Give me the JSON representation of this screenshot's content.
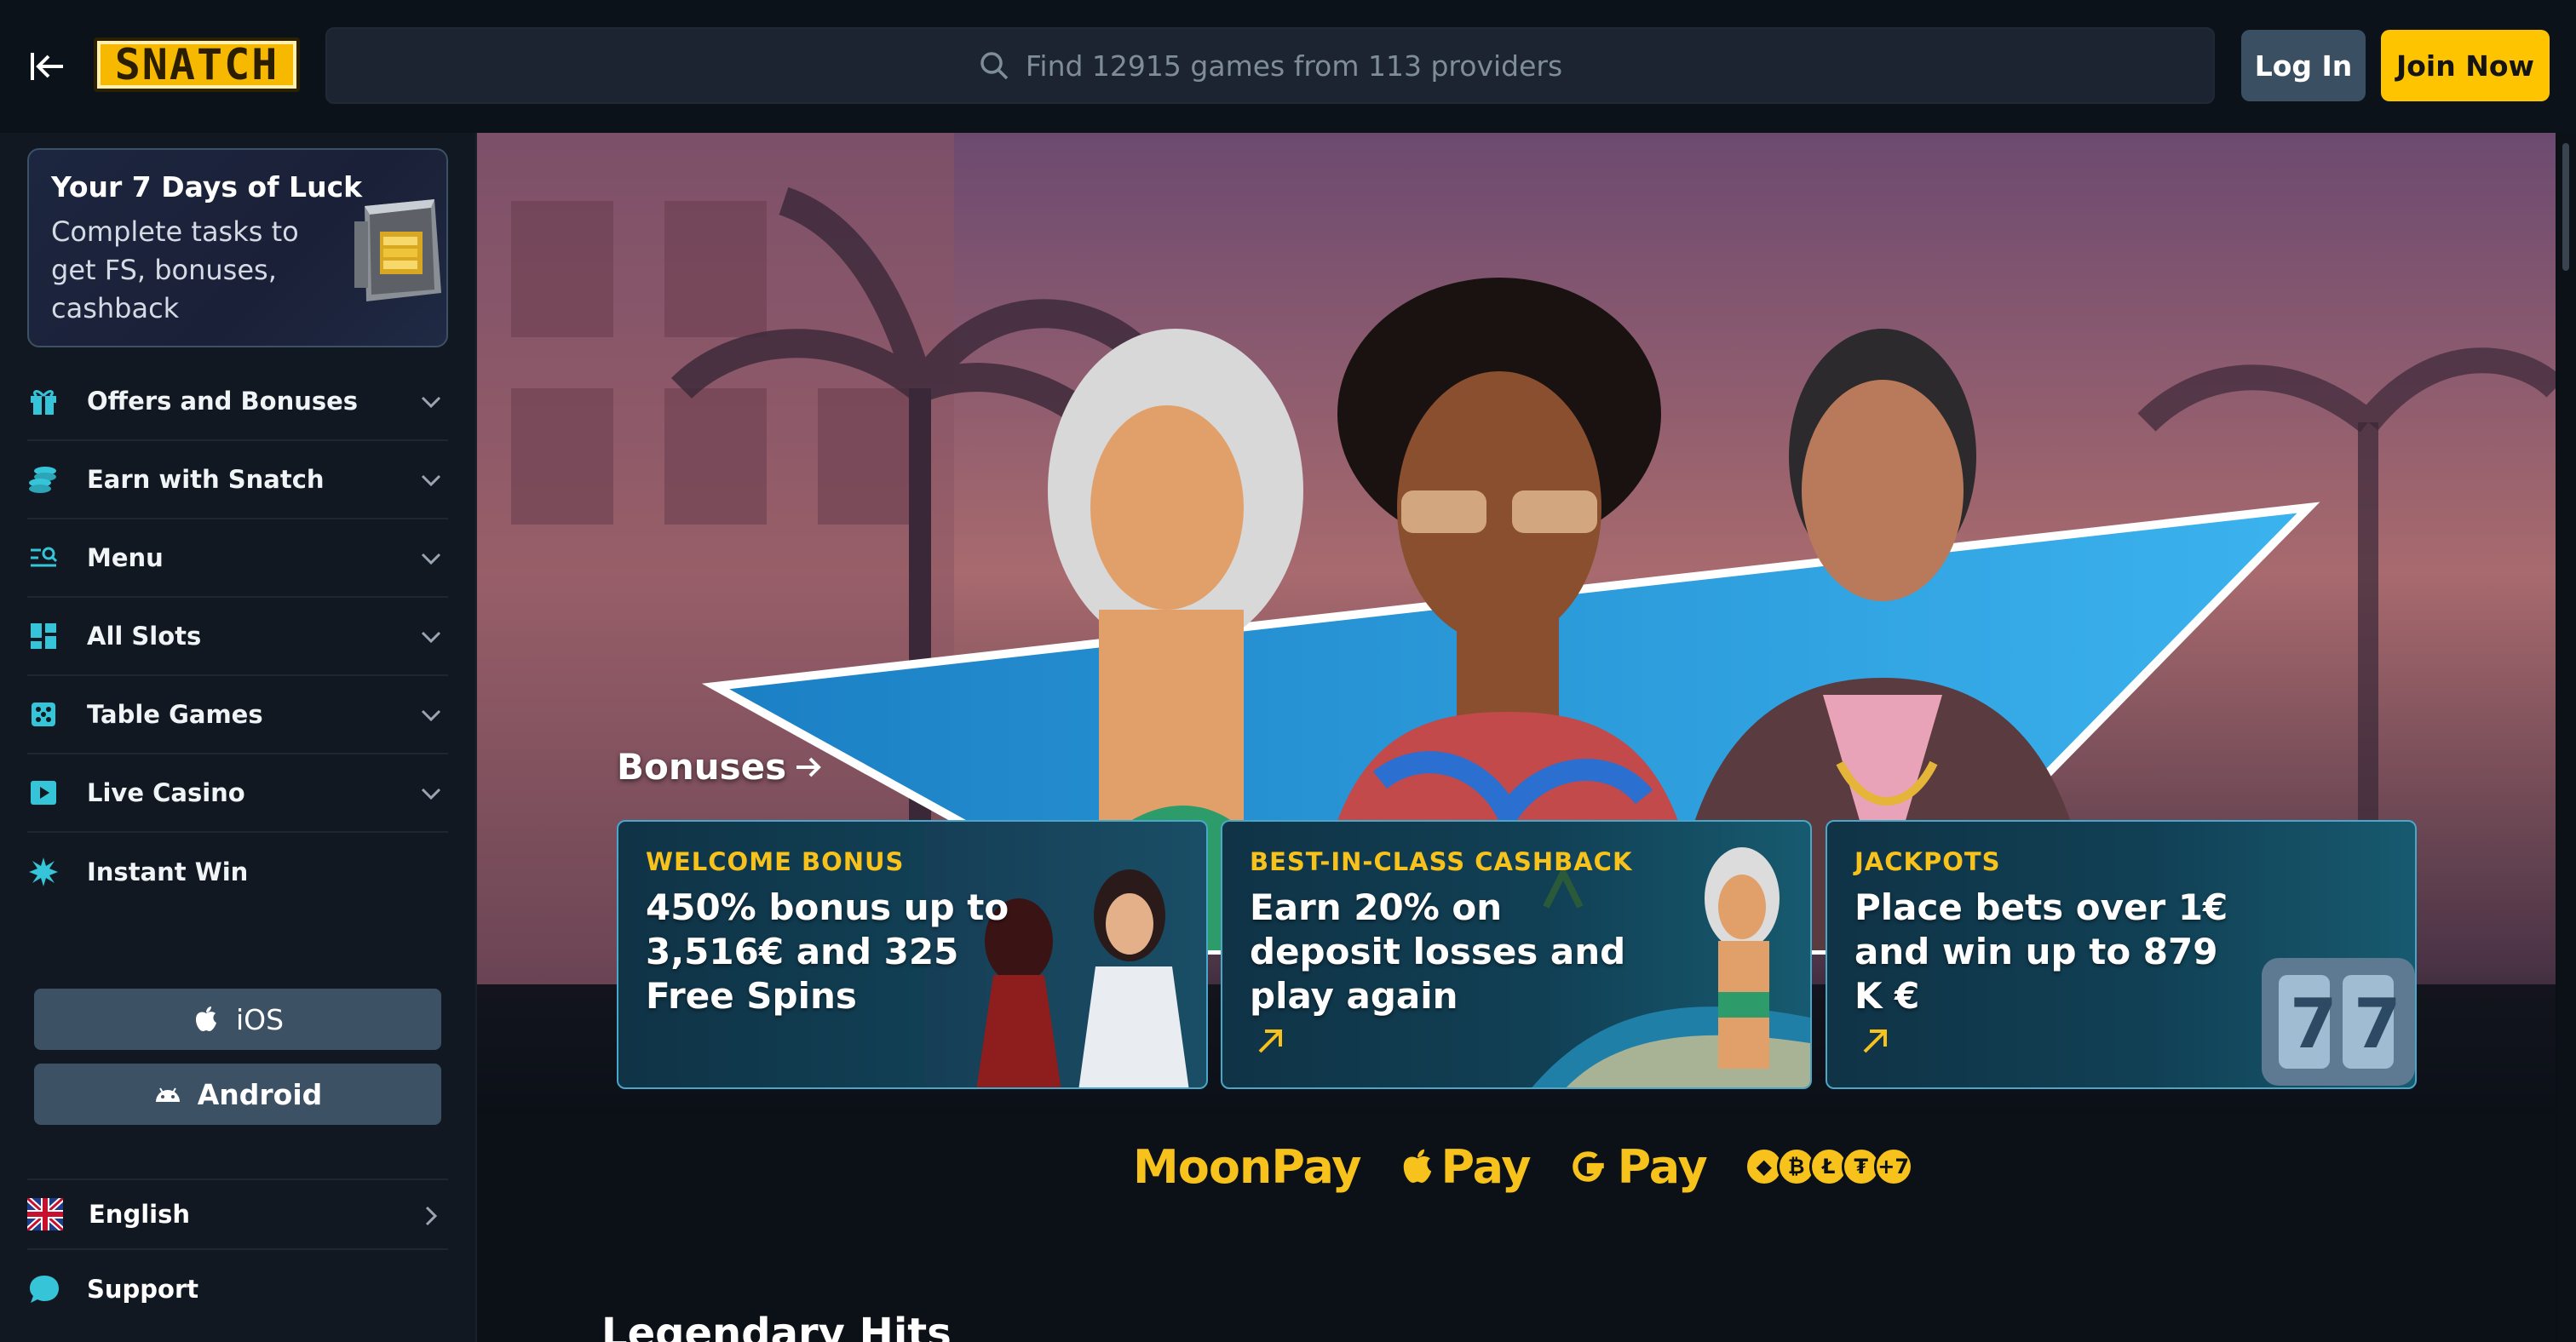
{
  "header": {
    "logo_text": "SNATCH",
    "search_placeholder": "Find 12915 games from 113 providers",
    "login_label": "Log In",
    "join_label": "Join Now"
  },
  "promo": {
    "title": "Your 7 Days of Luck",
    "text": "Complete tasks to get FS, bonuses, cashback"
  },
  "nav": [
    {
      "label": "Offers and Bonuses",
      "icon": "gift-icon"
    },
    {
      "label": "Earn with Snatch",
      "icon": "coins-icon"
    },
    {
      "label": "Menu",
      "icon": "menu-search-icon"
    },
    {
      "label": "All Slots",
      "icon": "grid-icon"
    },
    {
      "label": "Table Games",
      "icon": "dice-icon"
    },
    {
      "label": "Live Casino",
      "icon": "play-icon"
    },
    {
      "label": "Instant Win",
      "icon": "burst-icon"
    }
  ],
  "apps": {
    "ios": "iOS",
    "android": "Android"
  },
  "language": "English",
  "support": "Support",
  "main": {
    "bonuses_link": "Bonuses",
    "cards": [
      {
        "kicker": "WELCOME BONUS",
        "title": "450% bonus up to 3,516€ and 325 Free Spins"
      },
      {
        "kicker": "BEST-IN-CLASS CASHBACK",
        "title": "Earn 20% on deposit losses and play again"
      },
      {
        "kicker": "JACKPOTS",
        "title": "Place bets over 1€ and win up to 879 K €"
      }
    ],
    "payments": {
      "moonpay": "MoonPay",
      "applepay": "Pay",
      "gpay": "Pay",
      "crypto_more": "+7"
    },
    "section_title": "Legendary Hits"
  },
  "colors": {
    "accent": "#ffc400",
    "card_border": "#4aa7c9",
    "sidebar_bg": "#111821",
    "button_gray": "#3d5165"
  }
}
